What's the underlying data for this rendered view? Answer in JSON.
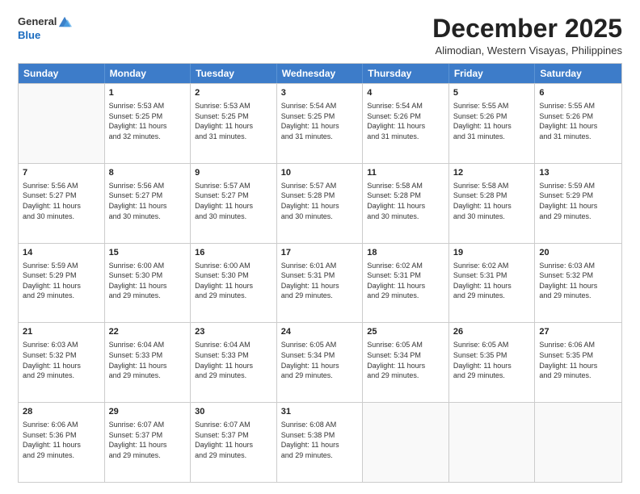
{
  "logo": {
    "general": "General",
    "blue": "Blue"
  },
  "title": "December 2025",
  "subtitle": "Alimodian, Western Visayas, Philippines",
  "calendar": {
    "headers": [
      "Sunday",
      "Monday",
      "Tuesday",
      "Wednesday",
      "Thursday",
      "Friday",
      "Saturday"
    ],
    "weeks": [
      [
        {
          "day": "",
          "info": ""
        },
        {
          "day": "1",
          "info": "Sunrise: 5:53 AM\nSunset: 5:25 PM\nDaylight: 11 hours\nand 32 minutes."
        },
        {
          "day": "2",
          "info": "Sunrise: 5:53 AM\nSunset: 5:25 PM\nDaylight: 11 hours\nand 31 minutes."
        },
        {
          "day": "3",
          "info": "Sunrise: 5:54 AM\nSunset: 5:25 PM\nDaylight: 11 hours\nand 31 minutes."
        },
        {
          "day": "4",
          "info": "Sunrise: 5:54 AM\nSunset: 5:26 PM\nDaylight: 11 hours\nand 31 minutes."
        },
        {
          "day": "5",
          "info": "Sunrise: 5:55 AM\nSunset: 5:26 PM\nDaylight: 11 hours\nand 31 minutes."
        },
        {
          "day": "6",
          "info": "Sunrise: 5:55 AM\nSunset: 5:26 PM\nDaylight: 11 hours\nand 31 minutes."
        }
      ],
      [
        {
          "day": "7",
          "info": "Sunrise: 5:56 AM\nSunset: 5:27 PM\nDaylight: 11 hours\nand 30 minutes."
        },
        {
          "day": "8",
          "info": "Sunrise: 5:56 AM\nSunset: 5:27 PM\nDaylight: 11 hours\nand 30 minutes."
        },
        {
          "day": "9",
          "info": "Sunrise: 5:57 AM\nSunset: 5:27 PM\nDaylight: 11 hours\nand 30 minutes."
        },
        {
          "day": "10",
          "info": "Sunrise: 5:57 AM\nSunset: 5:28 PM\nDaylight: 11 hours\nand 30 minutes."
        },
        {
          "day": "11",
          "info": "Sunrise: 5:58 AM\nSunset: 5:28 PM\nDaylight: 11 hours\nand 30 minutes."
        },
        {
          "day": "12",
          "info": "Sunrise: 5:58 AM\nSunset: 5:28 PM\nDaylight: 11 hours\nand 30 minutes."
        },
        {
          "day": "13",
          "info": "Sunrise: 5:59 AM\nSunset: 5:29 PM\nDaylight: 11 hours\nand 29 minutes."
        }
      ],
      [
        {
          "day": "14",
          "info": "Sunrise: 5:59 AM\nSunset: 5:29 PM\nDaylight: 11 hours\nand 29 minutes."
        },
        {
          "day": "15",
          "info": "Sunrise: 6:00 AM\nSunset: 5:30 PM\nDaylight: 11 hours\nand 29 minutes."
        },
        {
          "day": "16",
          "info": "Sunrise: 6:00 AM\nSunset: 5:30 PM\nDaylight: 11 hours\nand 29 minutes."
        },
        {
          "day": "17",
          "info": "Sunrise: 6:01 AM\nSunset: 5:31 PM\nDaylight: 11 hours\nand 29 minutes."
        },
        {
          "day": "18",
          "info": "Sunrise: 6:02 AM\nSunset: 5:31 PM\nDaylight: 11 hours\nand 29 minutes."
        },
        {
          "day": "19",
          "info": "Sunrise: 6:02 AM\nSunset: 5:31 PM\nDaylight: 11 hours\nand 29 minutes."
        },
        {
          "day": "20",
          "info": "Sunrise: 6:03 AM\nSunset: 5:32 PM\nDaylight: 11 hours\nand 29 minutes."
        }
      ],
      [
        {
          "day": "21",
          "info": "Sunrise: 6:03 AM\nSunset: 5:32 PM\nDaylight: 11 hours\nand 29 minutes."
        },
        {
          "day": "22",
          "info": "Sunrise: 6:04 AM\nSunset: 5:33 PM\nDaylight: 11 hours\nand 29 minutes."
        },
        {
          "day": "23",
          "info": "Sunrise: 6:04 AM\nSunset: 5:33 PM\nDaylight: 11 hours\nand 29 minutes."
        },
        {
          "day": "24",
          "info": "Sunrise: 6:05 AM\nSunset: 5:34 PM\nDaylight: 11 hours\nand 29 minutes."
        },
        {
          "day": "25",
          "info": "Sunrise: 6:05 AM\nSunset: 5:34 PM\nDaylight: 11 hours\nand 29 minutes."
        },
        {
          "day": "26",
          "info": "Sunrise: 6:05 AM\nSunset: 5:35 PM\nDaylight: 11 hours\nand 29 minutes."
        },
        {
          "day": "27",
          "info": "Sunrise: 6:06 AM\nSunset: 5:35 PM\nDaylight: 11 hours\nand 29 minutes."
        }
      ],
      [
        {
          "day": "28",
          "info": "Sunrise: 6:06 AM\nSunset: 5:36 PM\nDaylight: 11 hours\nand 29 minutes."
        },
        {
          "day": "29",
          "info": "Sunrise: 6:07 AM\nSunset: 5:37 PM\nDaylight: 11 hours\nand 29 minutes."
        },
        {
          "day": "30",
          "info": "Sunrise: 6:07 AM\nSunset: 5:37 PM\nDaylight: 11 hours\nand 29 minutes."
        },
        {
          "day": "31",
          "info": "Sunrise: 6:08 AM\nSunset: 5:38 PM\nDaylight: 11 hours\nand 29 minutes."
        },
        {
          "day": "",
          "info": ""
        },
        {
          "day": "",
          "info": ""
        },
        {
          "day": "",
          "info": ""
        }
      ]
    ]
  }
}
